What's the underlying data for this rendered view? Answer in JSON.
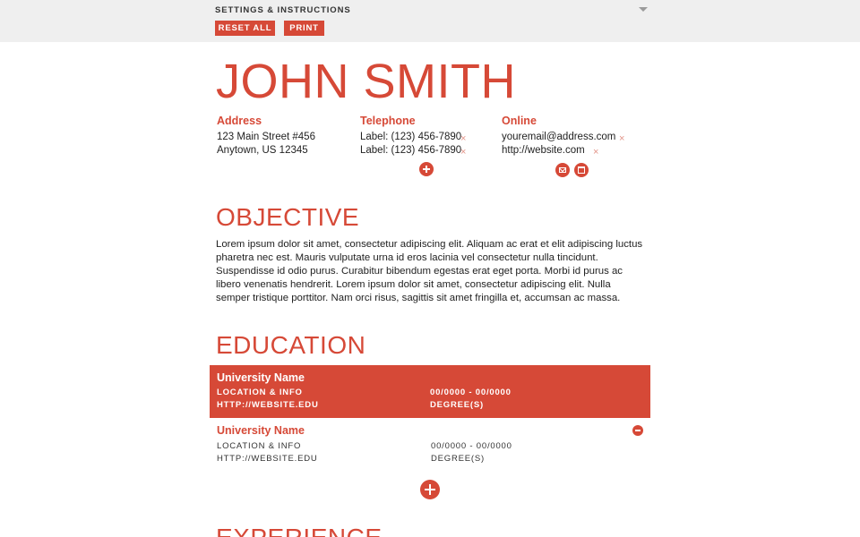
{
  "settings": {
    "title": "SETTINGS & INSTRUCTIONS",
    "reset_label": "RESET ALL",
    "print_label": "PRINT"
  },
  "resume": {
    "name": "JOHN SMITH",
    "accent_color": "#d64937",
    "contact": {
      "address": {
        "heading": "Address",
        "lines": [
          "123 Main Street #456",
          "Anytown, US 12345"
        ]
      },
      "telephone": {
        "heading": "Telephone",
        "lines": [
          "Label: (123) 456-7890",
          "Label: (123) 456-7890"
        ]
      },
      "online": {
        "heading": "Online",
        "lines": [
          "youremail@address.com",
          "http://website.com"
        ]
      }
    },
    "objective": {
      "heading": "OBJECTIVE",
      "text": "Lorem ipsum dolor sit amet, consectetur adipiscing elit. Aliquam ac erat et elit adipiscing luctus pharetra nec est. Mauris vulputate urna id eros lacinia vel consectetur nulla tincidunt. Suspendisse id odio purus. Curabitur bibendum egestas erat eget porta. Morbi id purus ac libero venenatis hendrerit. Lorem ipsum dolor sit amet, consectetur adipiscing elit. Nulla semper tristique porttitor. Nam orci risus, sagittis sit amet fringilla et, accumsan ac massa."
    },
    "education": {
      "heading": "EDUCATION",
      "entries": [
        {
          "university": "University Name",
          "location": "LOCATION & INFO",
          "website": "HTTP://WEBSITE.EDU",
          "dates": "00/0000 - 00/0000",
          "degree": "DEGREE(S)",
          "selected": true
        },
        {
          "university": "University Name",
          "location": "LOCATION & INFO",
          "website": "HTTP://WEBSITE.EDU",
          "dates": "00/0000 - 00/0000",
          "degree": "DEGREE(S)",
          "selected": false
        }
      ]
    },
    "experience": {
      "heading": "EXPERIENCE"
    }
  },
  "icons": {
    "remove": "×",
    "dropdown": "chevron-down-icon",
    "add": "plus-icon",
    "delete": "minus-icon",
    "email": "mail-icon",
    "website": "web-icon"
  }
}
